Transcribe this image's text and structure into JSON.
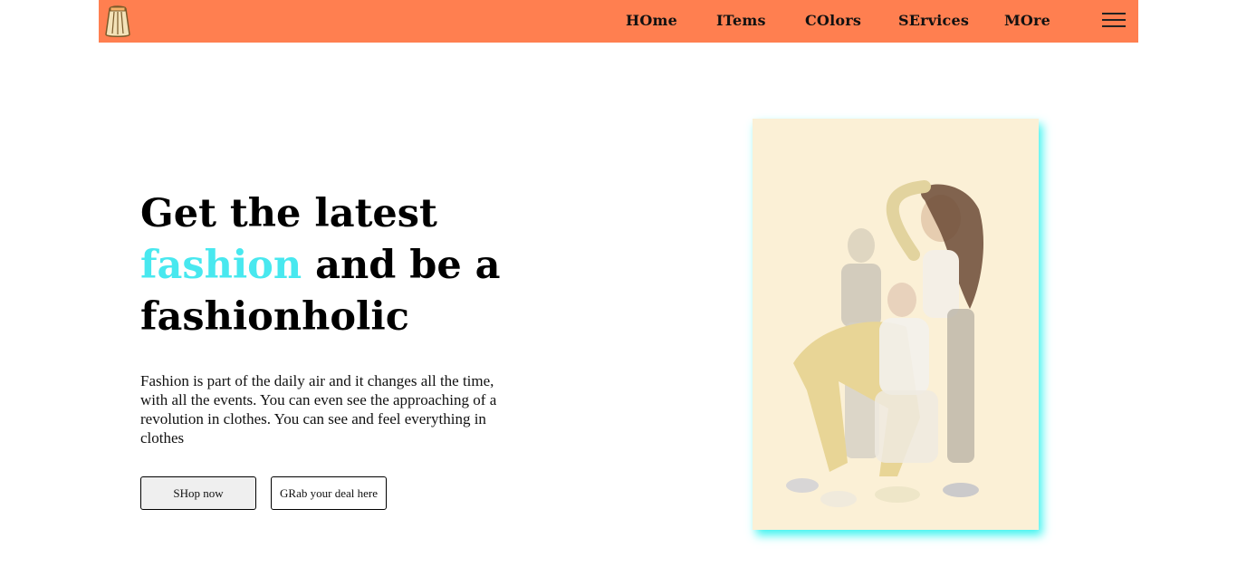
{
  "navbar": {
    "background": "#ff7f50",
    "logo_icon": "shopping-bag-icon",
    "links": [
      {
        "label": "HOme"
      },
      {
        "label": "ITems"
      },
      {
        "label": "COlors"
      },
      {
        "label": "SErvices"
      },
      {
        "label": "MOre"
      }
    ],
    "menu_icon": "hamburger-menu-icon"
  },
  "hero": {
    "title_part1": "Get the latest",
    "title_accent": "fashion",
    "title_part2": "and be a fashionholic",
    "accent_color": "#48e8ef",
    "description": "Fashion is part of the daily air and it changes all the time, with all the events. You can even see the approaching of a revolution in clothes. You can see and feel everything in clothes",
    "buttons": {
      "shop_label": "SHop now",
      "deal_label": "GRab your deal here"
    },
    "image": {
      "subject": "fashion-models-photo",
      "glow_color": "#3ef4f0"
    }
  }
}
